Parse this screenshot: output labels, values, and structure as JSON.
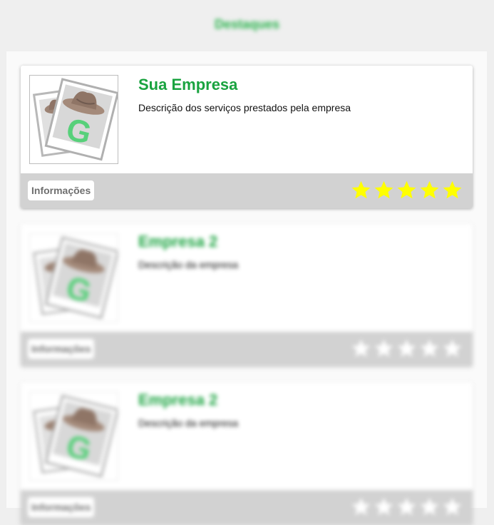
{
  "header": {
    "title": "Destaques"
  },
  "cards": [
    {
      "title": "Sua Empresa",
      "description": "Descrição dos serviços prestados pela empresa",
      "info_label": "Informações",
      "rating": 5,
      "star_color": "#ffff00",
      "logo_icon": "hat-g-logo-icon"
    },
    {
      "title": "Empresa 2",
      "description": "Descrição da empresa",
      "info_label": "Informações",
      "rating": 0,
      "star_color": "#ffffff",
      "logo_icon": "hat-g-logo-icon"
    },
    {
      "title": "Empresa 2",
      "description": "Descrição da empresa",
      "info_label": "Informações",
      "rating": 0,
      "star_color": "#ffffff",
      "logo_icon": "hat-g-logo-icon"
    }
  ],
  "colors": {
    "accent": "#19a33f",
    "footer_bg": "#d2d2d2",
    "page_bg": "#efefef"
  }
}
